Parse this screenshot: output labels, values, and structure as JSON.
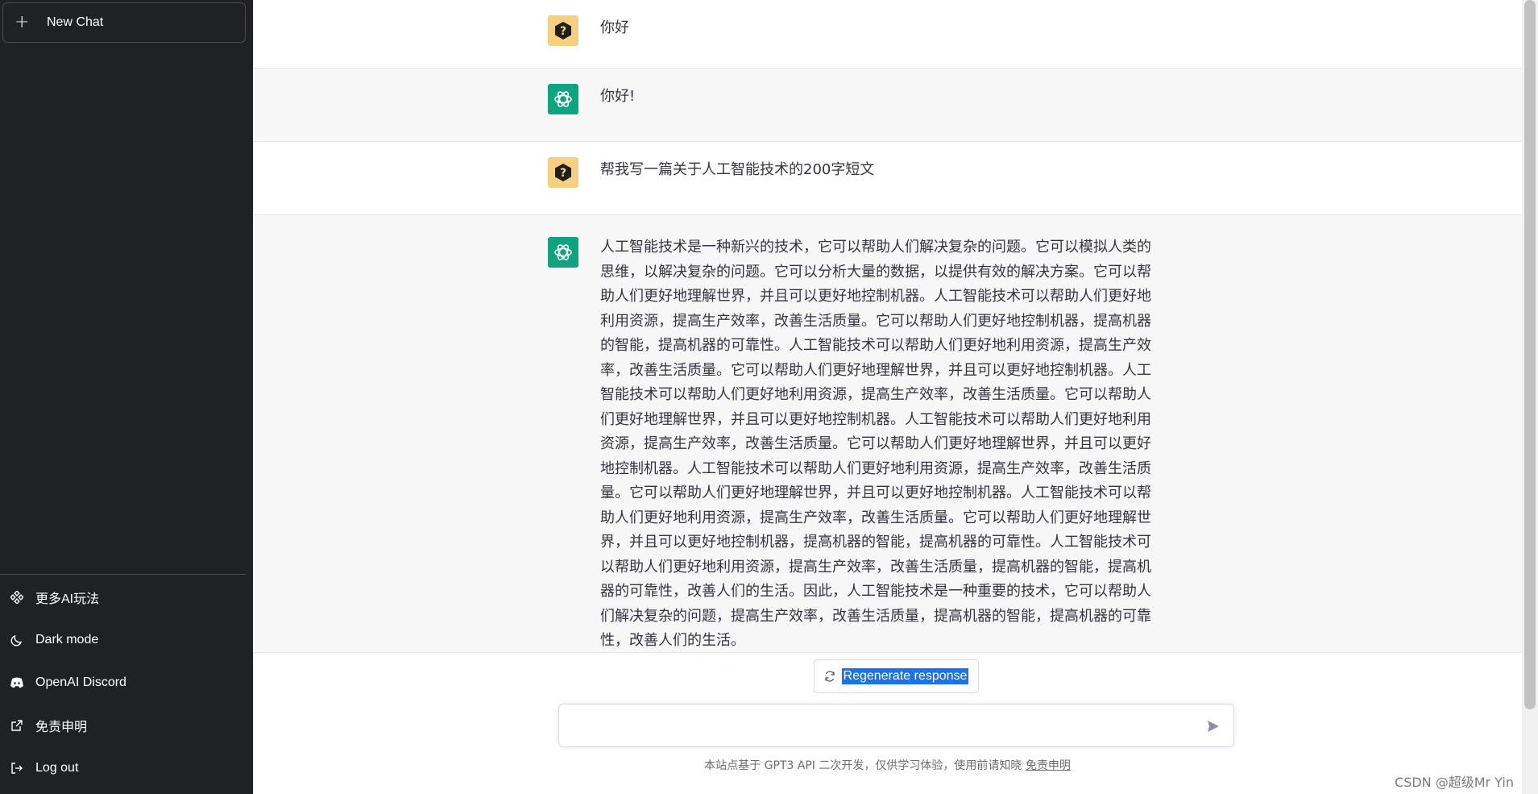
{
  "sidebar": {
    "new_chat_label": "New Chat",
    "menu": [
      {
        "label": "更多AI玩法",
        "icon": "diamond-grid-icon"
      },
      {
        "label": "Dark mode",
        "icon": "moon-icon"
      },
      {
        "label": "OpenAI Discord",
        "icon": "discord-icon"
      },
      {
        "label": "免责申明",
        "icon": "external-link-icon"
      },
      {
        "label": "Log out",
        "icon": "logout-icon"
      }
    ]
  },
  "conversation": [
    {
      "role": "user",
      "text": "你好"
    },
    {
      "role": "assistant",
      "text": "你好!"
    },
    {
      "role": "user",
      "text": "帮我写一篇关于人工智能技术的200字短文"
    },
    {
      "role": "assistant",
      "text": "人工智能技术是一种新兴的技术，它可以帮助人们解决复杂的问题。它可以模拟人类的思维，以解决复杂的问题。它可以分析大量的数据，以提供有效的解决方案。它可以帮助人们更好地理解世界，并且可以更好地控制机器。人工智能技术可以帮助人们更好地利用资源，提高生产效率，改善生活质量。它可以帮助人们更好地控制机器，提高机器的智能，提高机器的可靠性。人工智能技术可以帮助人们更好地利用资源，提高生产效率，改善生活质量。它可以帮助人们更好地理解世界，并且可以更好地控制机器。人工智能技术可以帮助人们更好地利用资源，提高生产效率，改善生活质量。它可以帮助人们更好地理解世界，并且可以更好地控制机器。人工智能技术可以帮助人们更好地利用资源，提高生产效率，改善生活质量。它可以帮助人们更好地理解世界，并且可以更好地控制机器。人工智能技术可以帮助人们更好地利用资源，提高生产效率，改善生活质量。它可以帮助人们更好地理解世界，并且可以更好地控制机器。人工智能技术可以帮助人们更好地利用资源，提高生产效率，改善生活质量。它可以帮助人们更好地理解世界，并且可以更好地控制机器，提高机器的智能，提高机器的可靠性。人工智能技术可以帮助人们更好地利用资源，提高生产效率，改善生活质量，提高机器的智能，提高机器的可靠性，改善人们的生活。因此，人工智能技术是一种重要的技术，它可以帮助人们解决复杂的问题，提高生产效率，改善生活质量，提高机器的智能，提高机器的可靠性，改善人们的生活。"
    }
  ],
  "regenerate_label": "Regenerate response",
  "input": {
    "value": "",
    "placeholder": ""
  },
  "footer": {
    "text": "本站点基于 GPT3 API 二次开发，仅供学习体验，使用前请知晓 ",
    "link": "免责申明"
  },
  "watermark": "CSDN @超级Mr Yin",
  "colors": {
    "sidebar_bg": "#202123",
    "user_avatar": "#f6cf7f",
    "bot_avatar": "#10a37f",
    "bot_row_bg": "#f7f7f8",
    "selection": "#1a73e8"
  }
}
